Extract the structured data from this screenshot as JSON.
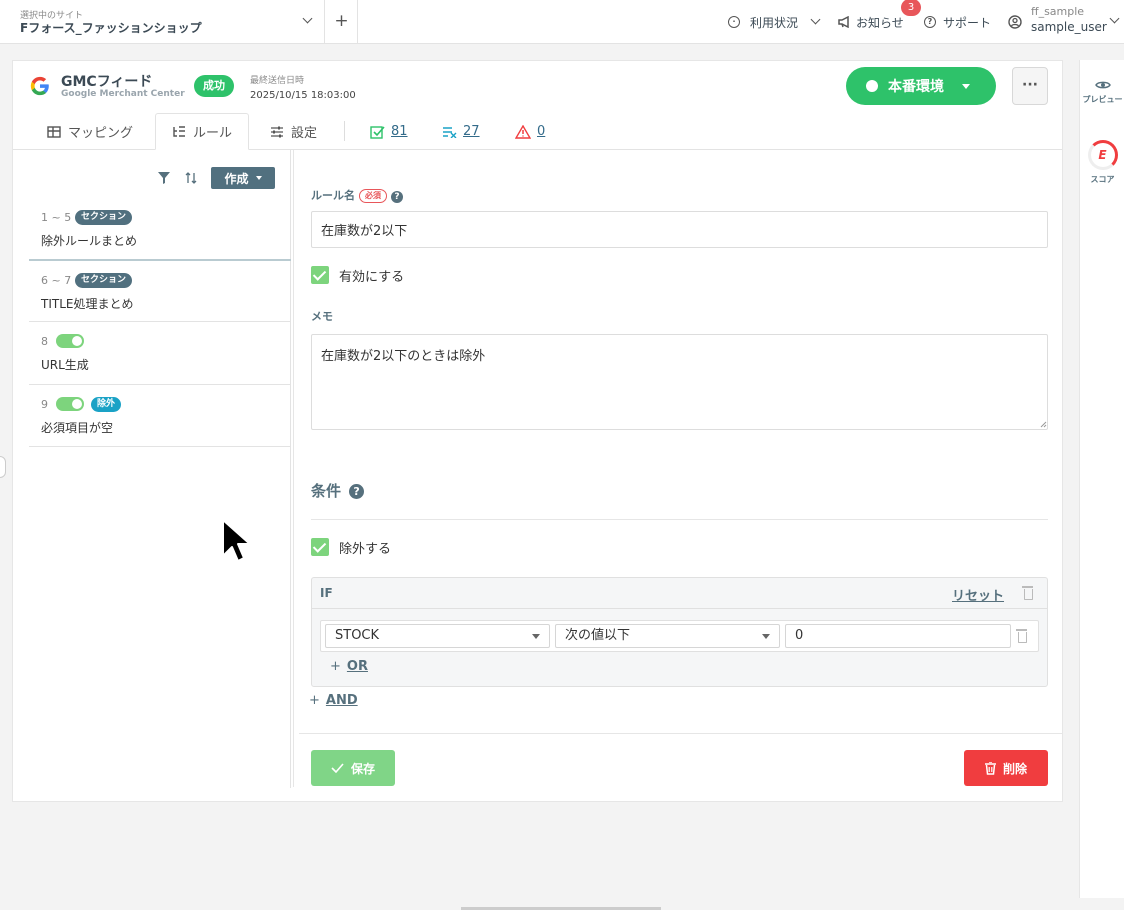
{
  "topbar": {
    "site_label": "選択中のサイト",
    "site_name": "Fフォース_ファッションショップ",
    "add_button": "+",
    "usage": "利用状況",
    "news": "お知らせ",
    "news_badge": "3",
    "support": "サポート",
    "user_small": "ff_sample",
    "user_name": "sample_user"
  },
  "feed": {
    "title": "GMCフィード",
    "subtitle": "Google Merchant Center",
    "status_badge": "成功",
    "last_sent_label": "最終送信日時",
    "last_sent_value": "2025/10/15 18:03:00",
    "env_button": "本番環境",
    "more_button": "···"
  },
  "tabs": [
    {
      "label": "マッピング"
    },
    {
      "label": "ルール"
    },
    {
      "label": "設定"
    }
  ],
  "stats": {
    "ok_count": "81",
    "excluded_count": "27",
    "warning_count": "0"
  },
  "left": {
    "create_button": "作成",
    "rules": [
      {
        "num": "1 ~ 5",
        "badge": "セクション",
        "name": "除外ルールまとめ"
      },
      {
        "num": "6 ~ 7",
        "badge": "セクション",
        "name": "TITLE処理まとめ"
      },
      {
        "num": "8",
        "name": "URL生成"
      },
      {
        "num": "9",
        "badge": "除外",
        "name": "必須項目が空"
      }
    ]
  },
  "form": {
    "rule_name_label": "ルール名",
    "required_badge": "必須",
    "help_mark": "?",
    "rule_name_value": "在庫数が2以下",
    "enable_label": "有効にする",
    "memo_label": "メモ",
    "memo_value": "在庫数が2以下のときは除外",
    "condition_title": "条件",
    "exclude_label": "除外する",
    "if_label": "IF",
    "reset_link": "リセット",
    "field_select": "STOCK",
    "operator_select": "次の値以下",
    "value_input": "0",
    "or_link": "OR",
    "and_link": "AND",
    "save_button": "保存",
    "delete_button": "削除",
    "plus": "+"
  },
  "rail": {
    "preview": "プレビュー",
    "score": "スコア",
    "score_letter": "E"
  },
  "colors": {
    "success": "#2ec26a",
    "danger": "#f03d3f",
    "slate": "#51707f",
    "check": "#7dd47d"
  }
}
